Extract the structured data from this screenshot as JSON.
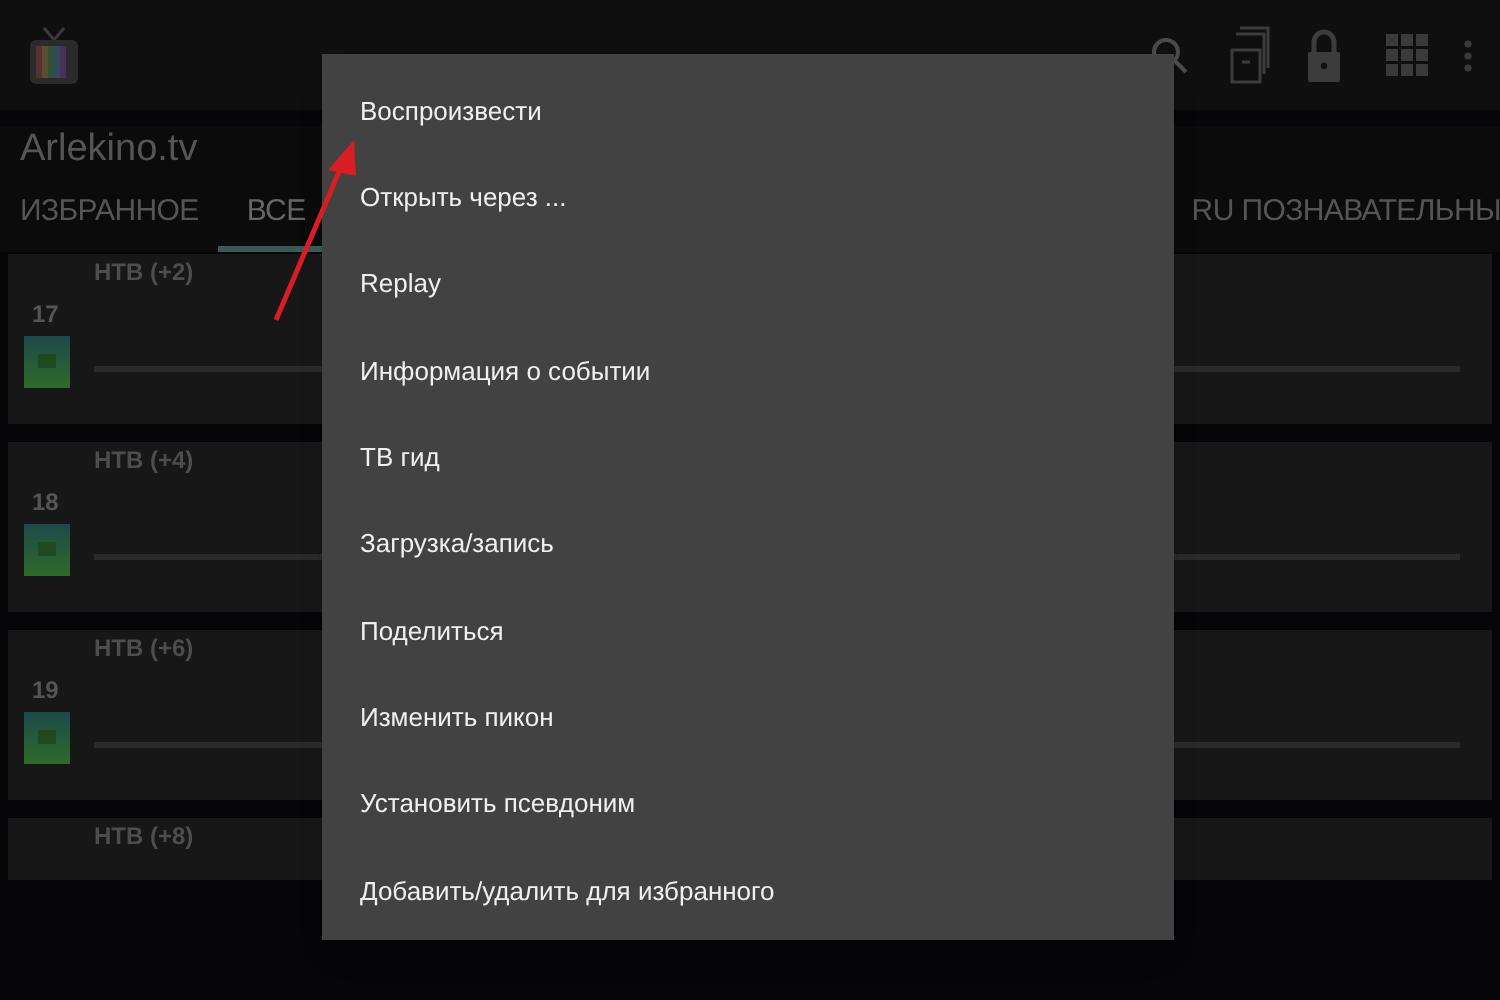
{
  "app_bar": {
    "title": "Arlekino.tv"
  },
  "tabs": [
    {
      "label": "ИЗБРАННОЕ",
      "selected": false
    },
    {
      "label": "ВСЕ",
      "selected": true
    },
    {
      "label": "RU ПОЗНАВАТЕЛЬНЫ",
      "selected": false
    }
  ],
  "channels": [
    {
      "number": "17",
      "name": "НТВ (+2)"
    },
    {
      "number": "18",
      "name": "НТВ (+4)"
    },
    {
      "number": "19",
      "name": "НТВ (+6)"
    },
    {
      "name": "НТВ (+8)"
    }
  ],
  "context_menu": {
    "items": [
      "Воспроизвести",
      "Открыть через ...",
      "Replay",
      "Информация о событии",
      "ТВ гид",
      "Загрузка/запись",
      "Поделиться",
      "Изменить пикон",
      "Установить псевдоним",
      "Добавить/удалить для избранного"
    ]
  }
}
